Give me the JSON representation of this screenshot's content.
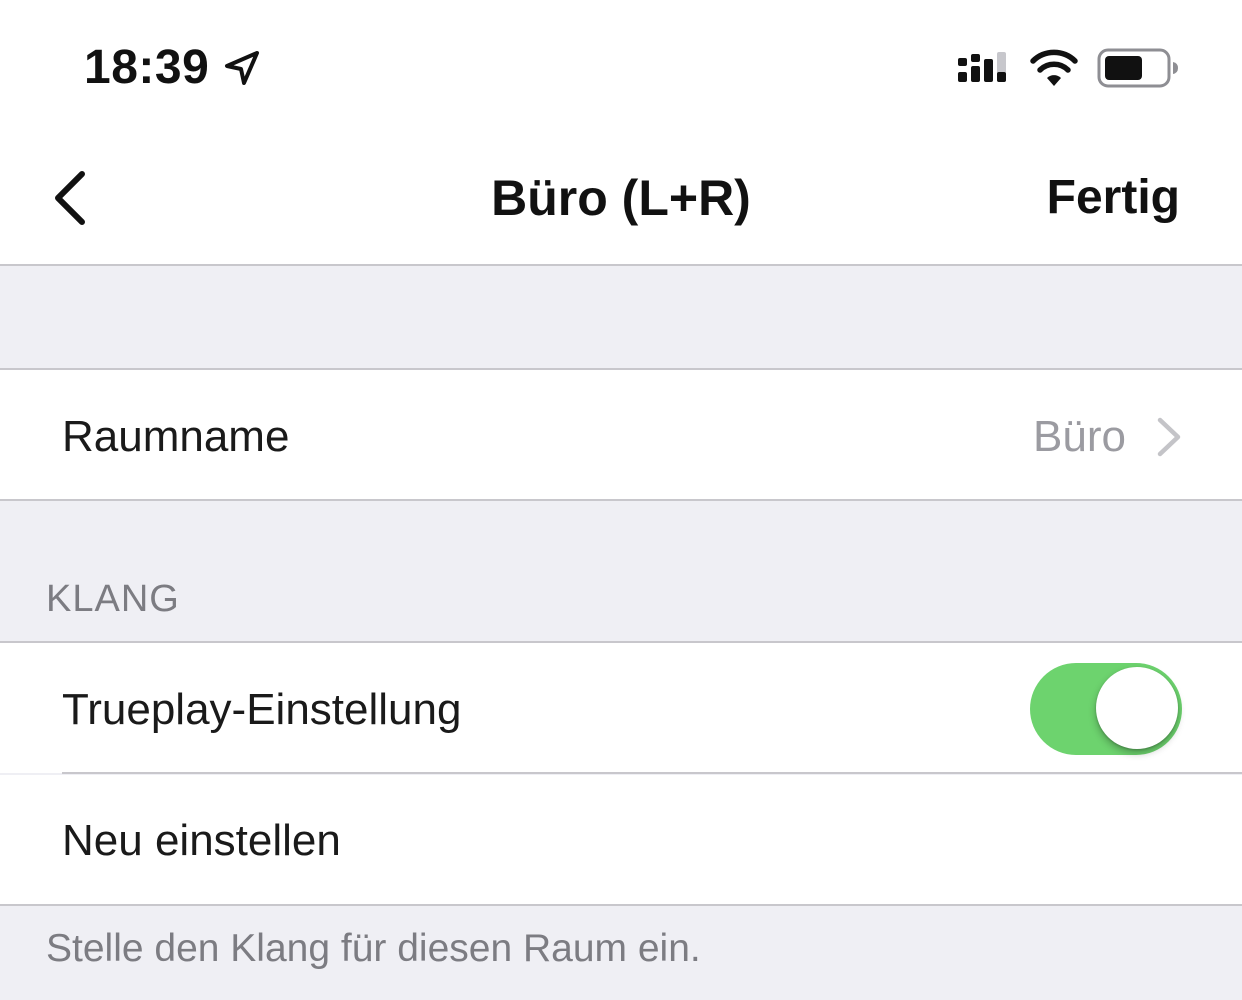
{
  "status_bar": {
    "time": "18:39",
    "icons": [
      "location-arrow-icon",
      "cellular-signal-icon",
      "wifi-icon",
      "battery-icon"
    ]
  },
  "nav": {
    "back_icon": "chevron-left-icon",
    "title": "Büro (L+R)",
    "done_label": "Fertig"
  },
  "room_row": {
    "label": "Raumname",
    "value": "Büro",
    "icon": "chevron-right-icon"
  },
  "sound_section": {
    "header": "KLANG",
    "trueplay_label": "Trueplay-Einstellung",
    "trueplay_enabled": true,
    "reset_label": "Neu einstellen",
    "footer": "Stelle den Klang für diesen Raum ein."
  },
  "colors": {
    "toggle_on": "#6dd36e",
    "grouped_background": "#efeff4",
    "secondary_text": "#7c7c82",
    "separator": "#c8c7cc"
  }
}
